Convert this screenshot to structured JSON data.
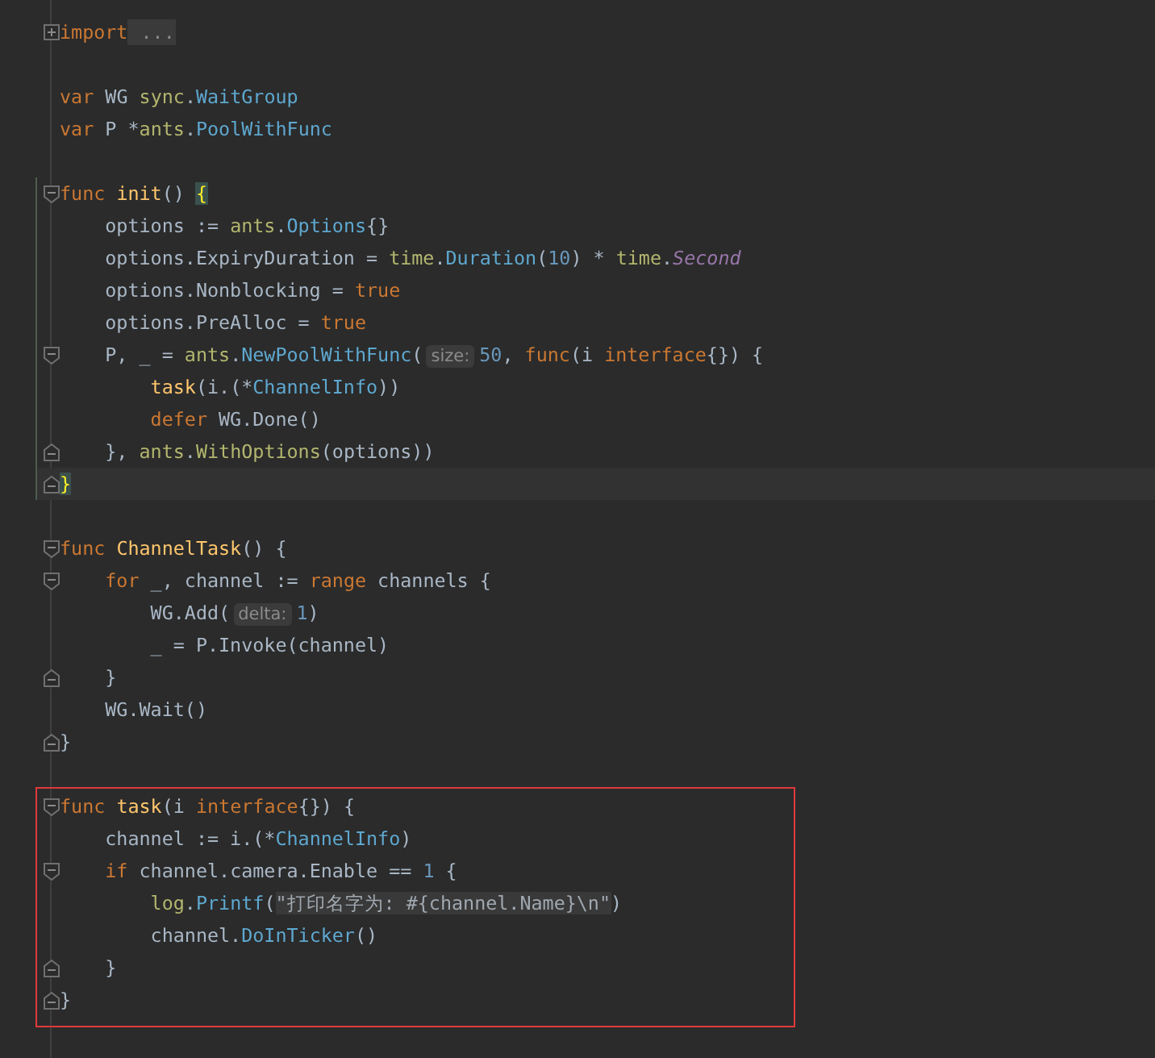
{
  "editor": {
    "sections": [
      {
        "changed": false,
        "boxed": false,
        "lines": [
          {
            "kind": "collapsed",
            "current": false,
            "tokens": [
              {
                "kind": "keyword",
                "text": "import"
              },
              {
                "kind": "folded",
                "text": " ..."
              }
            ]
          },
          {
            "kind": "blank",
            "current": false
          },
          {
            "kind": "code",
            "current": false,
            "tokens": [
              {
                "kind": "keyword",
                "text": "var"
              },
              {
                "kind": "plain",
                "text": " WG "
              },
              {
                "kind": "package",
                "text": "sync"
              },
              {
                "kind": "plain",
                "text": "."
              },
              {
                "kind": "type",
                "text": "WaitGroup"
              }
            ]
          },
          {
            "kind": "code",
            "current": false,
            "tokens": [
              {
                "kind": "keyword",
                "text": "var"
              },
              {
                "kind": "plain",
                "text": " P *"
              },
              {
                "kind": "package",
                "text": "ants"
              },
              {
                "kind": "plain",
                "text": "."
              },
              {
                "kind": "type",
                "text": "PoolWithFunc"
              }
            ]
          },
          {
            "kind": "blank",
            "current": false
          }
        ]
      },
      {
        "changed": true,
        "boxed": false,
        "lines": [
          {
            "kind": "foldstart",
            "current": false,
            "tokens": [
              {
                "kind": "keyword",
                "text": "func"
              },
              {
                "kind": "func",
                "text": " init"
              },
              {
                "kind": "plain",
                "text": "() "
              },
              {
                "kind": "brace",
                "text": "{"
              }
            ]
          },
          {
            "kind": "code",
            "current": false,
            "tokens": [
              {
                "kind": "plain",
                "text": "    options := "
              },
              {
                "kind": "package",
                "text": "ants"
              },
              {
                "kind": "plain",
                "text": "."
              },
              {
                "kind": "type",
                "text": "Options"
              },
              {
                "kind": "plain",
                "text": "{}"
              }
            ]
          },
          {
            "kind": "code",
            "current": false,
            "tokens": [
              {
                "kind": "plain",
                "text": "    options.ExpiryDuration = "
              },
              {
                "kind": "package",
                "text": "time"
              },
              {
                "kind": "plain",
                "text": "."
              },
              {
                "kind": "type",
                "text": "Duration"
              },
              {
                "kind": "plain",
                "text": "("
              },
              {
                "kind": "number",
                "text": "10"
              },
              {
                "kind": "plain",
                "text": ") * "
              },
              {
                "kind": "package",
                "text": "time"
              },
              {
                "kind": "plain",
                "text": "."
              },
              {
                "kind": "constant",
                "text": "Second"
              }
            ]
          },
          {
            "kind": "code",
            "current": false,
            "tokens": [
              {
                "kind": "plain",
                "text": "    options.Nonblocking = "
              },
              {
                "kind": "keyword",
                "text": "true"
              }
            ]
          },
          {
            "kind": "code",
            "current": false,
            "tokens": [
              {
                "kind": "plain",
                "text": "    options.PreAlloc = "
              },
              {
                "kind": "keyword",
                "text": "true"
              }
            ]
          },
          {
            "kind": "foldstart",
            "current": false,
            "tokens": [
              {
                "kind": "plain",
                "text": "    P, _ = "
              },
              {
                "kind": "package",
                "text": "ants"
              },
              {
                "kind": "plain",
                "text": "."
              },
              {
                "kind": "type",
                "text": "NewPoolWithFunc"
              },
              {
                "kind": "plain",
                "text": "("
              },
              {
                "kind": "hint",
                "text": "size:"
              },
              {
                "kind": "number",
                "text": "50"
              },
              {
                "kind": "plain",
                "text": ", "
              },
              {
                "kind": "keyword",
                "text": "func"
              },
              {
                "kind": "plain",
                "text": "(i "
              },
              {
                "kind": "keyword",
                "text": "interface"
              },
              {
                "kind": "plain",
                "text": "{}) {"
              }
            ]
          },
          {
            "kind": "code",
            "current": false,
            "tokens": [
              {
                "kind": "func",
                "text": "        task"
              },
              {
                "kind": "plain",
                "text": "(i.(*"
              },
              {
                "kind": "type",
                "text": "ChannelInfo"
              },
              {
                "kind": "plain",
                "text": "))"
              }
            ]
          },
          {
            "kind": "code",
            "current": false,
            "tokens": [
              {
                "kind": "keyword",
                "text": "        defer"
              },
              {
                "kind": "plain",
                "text": " WG.Done()"
              }
            ]
          },
          {
            "kind": "foldend",
            "current": false,
            "tokens": [
              {
                "kind": "plain",
                "text": "    }, "
              },
              {
                "kind": "package",
                "text": "ants"
              },
              {
                "kind": "plain",
                "text": "."
              },
              {
                "kind": "package",
                "text": "WithOptions"
              },
              {
                "kind": "plain",
                "text": "(options))"
              }
            ]
          },
          {
            "kind": "foldend",
            "current": true,
            "tokens": [
              {
                "kind": "brace",
                "text": "}"
              }
            ]
          }
        ]
      },
      {
        "changed": false,
        "boxed": false,
        "lines": [
          {
            "kind": "blank",
            "current": false
          },
          {
            "kind": "foldstart",
            "current": false,
            "tokens": [
              {
                "kind": "keyword",
                "text": "func"
              },
              {
                "kind": "func",
                "text": " ChannelTask"
              },
              {
                "kind": "plain",
                "text": "() {"
              }
            ]
          },
          {
            "kind": "foldstart",
            "current": false,
            "tokens": [
              {
                "kind": "keyword",
                "text": "    for"
              },
              {
                "kind": "plain",
                "text": " _, channel := "
              },
              {
                "kind": "keyword",
                "text": "range"
              },
              {
                "kind": "plain",
                "text": " channels {"
              }
            ]
          },
          {
            "kind": "code",
            "current": false,
            "tokens": [
              {
                "kind": "plain",
                "text": "        WG.Add("
              },
              {
                "kind": "hint",
                "text": "delta:"
              },
              {
                "kind": "number",
                "text": "1"
              },
              {
                "kind": "plain",
                "text": ")"
              }
            ]
          },
          {
            "kind": "code",
            "current": false,
            "tokens": [
              {
                "kind": "plain",
                "text": "        _ = P.Invoke(channel)"
              }
            ]
          },
          {
            "kind": "foldend",
            "current": false,
            "tokens": [
              {
                "kind": "plain",
                "text": "    }"
              }
            ]
          },
          {
            "kind": "code",
            "current": false,
            "tokens": [
              {
                "kind": "plain",
                "text": "    WG.Wait()"
              }
            ]
          },
          {
            "kind": "foldend",
            "current": false,
            "tokens": [
              {
                "kind": "plain",
                "text": "}"
              }
            ]
          },
          {
            "kind": "blank",
            "current": false
          }
        ]
      },
      {
        "changed": false,
        "boxed": true,
        "lines": [
          {
            "kind": "foldstart",
            "current": false,
            "tokens": [
              {
                "kind": "keyword",
                "text": "func"
              },
              {
                "kind": "func",
                "text": " task"
              },
              {
                "kind": "plain",
                "text": "(i "
              },
              {
                "kind": "keyword",
                "text": "interface"
              },
              {
                "kind": "plain",
                "text": "{}) {"
              }
            ]
          },
          {
            "kind": "code",
            "current": false,
            "tokens": [
              {
                "kind": "plain",
                "text": "    channel := i.(*"
              },
              {
                "kind": "type",
                "text": "ChannelInfo"
              },
              {
                "kind": "plain",
                "text": ")"
              }
            ]
          },
          {
            "kind": "foldstart",
            "current": false,
            "tokens": [
              {
                "kind": "keyword",
                "text": "    if"
              },
              {
                "kind": "plain",
                "text": " channel.camera.Enable == "
              },
              {
                "kind": "number",
                "text": "1"
              },
              {
                "kind": "plain",
                "text": " {"
              }
            ]
          },
          {
            "kind": "code",
            "current": false,
            "tokens": [
              {
                "kind": "package",
                "text": "        log"
              },
              {
                "kind": "plain",
                "text": "."
              },
              {
                "kind": "type",
                "text": "Printf"
              },
              {
                "kind": "plain",
                "text": "("
              },
              {
                "kind": "string",
                "text": "\"打印名字为: #{channel.Name}\\n\""
              },
              {
                "kind": "plain",
                "text": ")"
              }
            ]
          },
          {
            "kind": "code",
            "current": false,
            "tokens": [
              {
                "kind": "plain",
                "text": "        channel."
              },
              {
                "kind": "type",
                "text": "DoInTicker"
              },
              {
                "kind": "plain",
                "text": "()"
              }
            ]
          },
          {
            "kind": "foldend",
            "current": false,
            "tokens": [
              {
                "kind": "plain",
                "text": "    }"
              }
            ]
          },
          {
            "kind": "foldend",
            "current": false,
            "tokens": [
              {
                "kind": "plain",
                "text": "}"
              }
            ]
          }
        ]
      }
    ]
  }
}
